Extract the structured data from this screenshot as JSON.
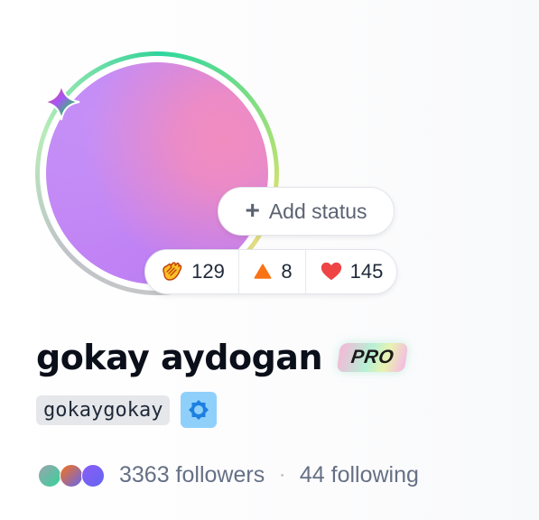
{
  "profile": {
    "display_name": "gokay aydogan",
    "badge": "PRO",
    "username": "gokaygokay",
    "status_label": "Add status",
    "reactions": [
      {
        "icon": "clap-icon",
        "count": "129"
      },
      {
        "icon": "triangle-icon",
        "count": "8"
      },
      {
        "icon": "heart-icon",
        "count": "145"
      }
    ],
    "followers_label": "3363 followers",
    "separator": "·",
    "following_label": "44 following"
  },
  "colors": {
    "avatar_purple": "#c283f4",
    "avatar_pink": "#f28cbf",
    "ring_green": "#34d399",
    "verify_blue": "#8fd0fb",
    "triangle_orange": "#f97316",
    "heart_red": "#ef4444"
  }
}
